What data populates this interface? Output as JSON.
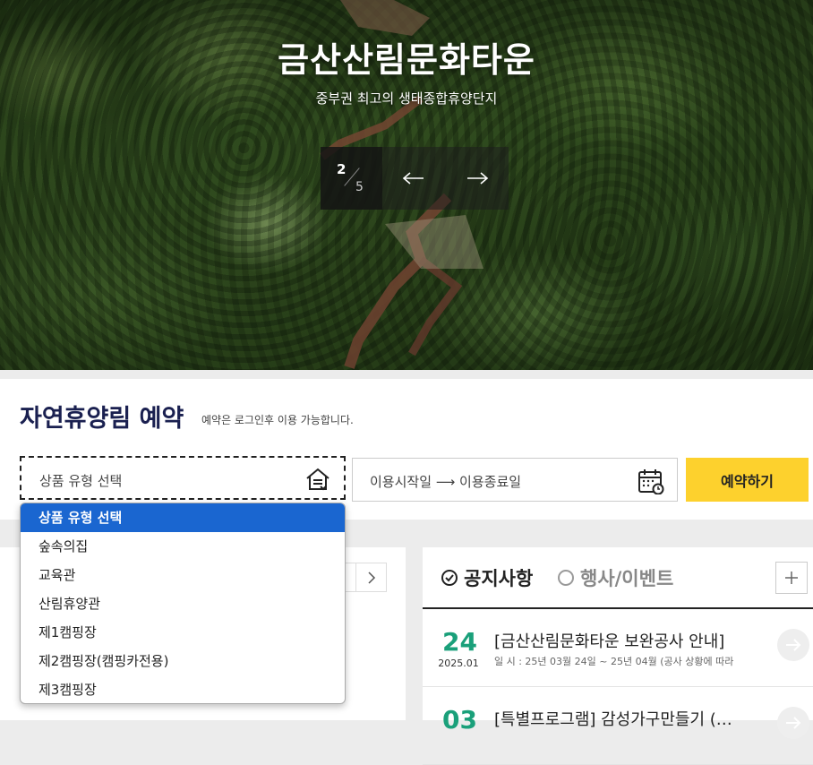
{
  "hero": {
    "title": "금산산림문화타운",
    "subtitle": "중부권 최고의 생태종합휴양단지",
    "slide_current": "2",
    "slide_total": "5"
  },
  "booking": {
    "title": "자연휴양림 예약",
    "note": "예약은 로그인후 이용 가능합니다.",
    "select_label": "상품 유형 선택",
    "date_label": "이용시작일 ⟶ 이용종료일",
    "reserve_label": "예약하기",
    "dropdown_options": [
      "상품 유형 선택",
      "숲속의집",
      "교육관",
      "산림휴양관",
      "제1캠핑장",
      "제2캠핑장(캠핑카전용)",
      "제3캠핑장"
    ],
    "accent_color": "#fdd12d",
    "selected_color": "#1a66d0"
  },
  "notices": {
    "tab_active": "공지사항",
    "tab_inactive": "행사/이벤트",
    "items": [
      {
        "day": "24",
        "ym": "2025.01",
        "title": "[금산산림문화타운 보완공사 안내]",
        "meta": "일 시 : 25년 03월 24일 ~ 25년 04월 (공사 상황에 따라"
      },
      {
        "day": "03",
        "ym": "",
        "title": "[특별프로그램] 감성가구만들기 (…",
        "meta": ""
      }
    ],
    "day_color": "#1aa07a"
  },
  "icons": [
    "house-list-icon",
    "calendar-icon",
    "arrow-left-icon",
    "arrow-right-icon",
    "check-circle-icon",
    "circle-icon",
    "plus-icon",
    "chevron-right-icon"
  ]
}
